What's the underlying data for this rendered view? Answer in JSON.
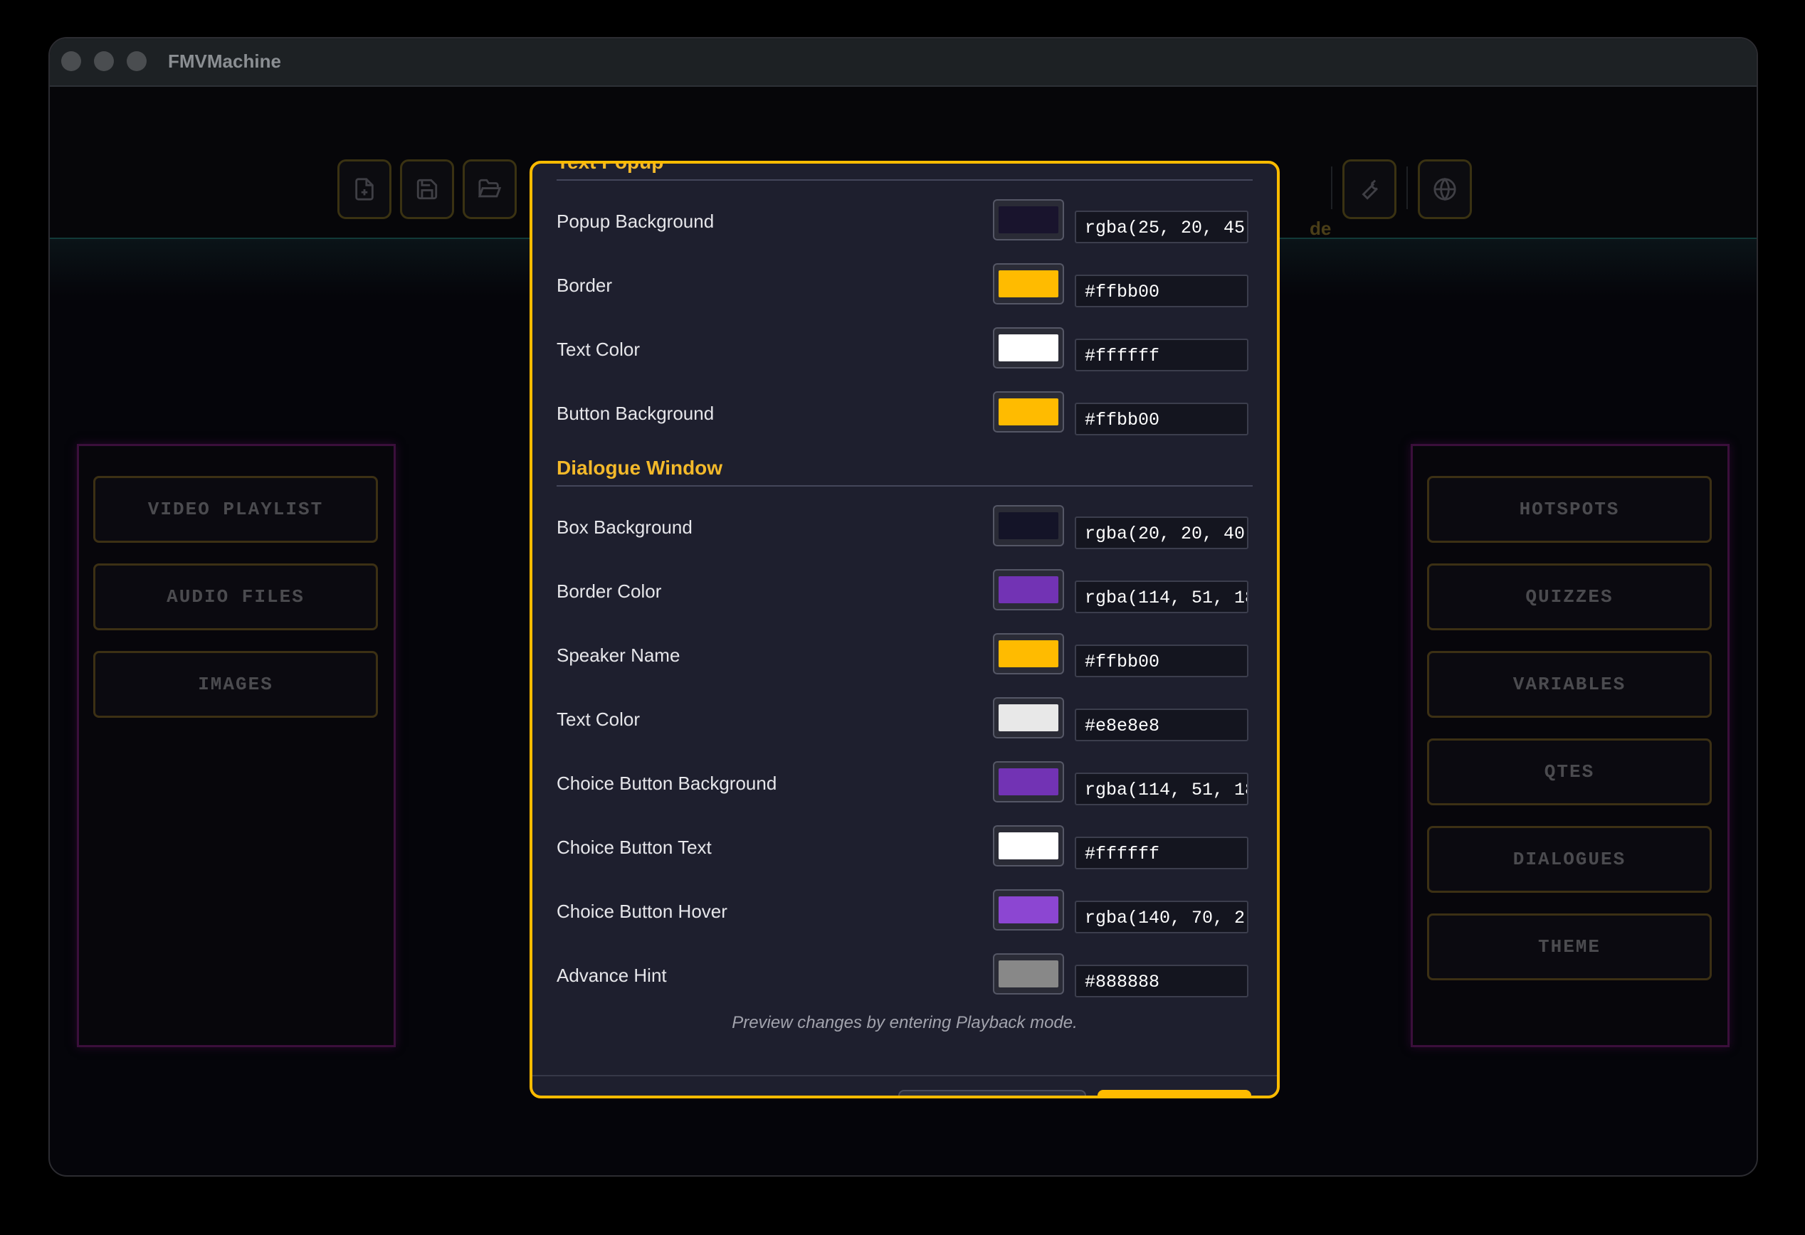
{
  "window": {
    "title": "FMVMachine"
  },
  "toolbar": {
    "new_icon": "file-plus-icon",
    "save_icon": "save-icon",
    "open_icon": "folder-open-icon",
    "mode_fragment": "de",
    "tools_icon": "wrench-icon",
    "globe_icon": "globe-icon"
  },
  "left_panel": {
    "items": [
      "VIDEO PLAYLIST",
      "AUDIO FILES",
      "IMAGES"
    ]
  },
  "right_panel": {
    "items": [
      "HOTSPOTS",
      "QUIZZES",
      "VARIABLES",
      "QTES",
      "DIALOGUES",
      "THEME"
    ]
  },
  "modal": {
    "sections": [
      {
        "title": "Text Popup",
        "rows": [
          {
            "label": "Popup Background",
            "value": "rgba(25, 20, 45",
            "swatch": "#19142d"
          },
          {
            "label": "Border",
            "value": "#ffbb00",
            "swatch": "#ffbb00"
          },
          {
            "label": "Text Color",
            "value": "#ffffff",
            "swatch": "#ffffff"
          },
          {
            "label": "Button Background",
            "value": "#ffbb00",
            "swatch": "#ffbb00"
          }
        ]
      },
      {
        "title": "Dialogue Window",
        "rows": [
          {
            "label": "Box Background",
            "value": "rgba(20, 20, 40",
            "swatch": "#141428"
          },
          {
            "label": "Border Color",
            "value": "rgba(114, 51, 18",
            "swatch": "#7233b4"
          },
          {
            "label": "Speaker Name",
            "value": "#ffbb00",
            "swatch": "#ffbb00"
          },
          {
            "label": "Text Color",
            "value": "#e8e8e8",
            "swatch": "#e8e8e8"
          },
          {
            "label": "Choice Button Background",
            "value": "rgba(114, 51, 18",
            "swatch": "#7233b4"
          },
          {
            "label": "Choice Button Text",
            "value": "#ffffff",
            "swatch": "#ffffff"
          },
          {
            "label": "Choice Button Hover",
            "value": "rgba(140, 70, 2",
            "swatch": "#8c46d2"
          },
          {
            "label": "Advance Hint",
            "value": "#888888",
            "swatch": "#888888"
          }
        ]
      }
    ],
    "hint": "Preview changes by entering Playback mode."
  }
}
